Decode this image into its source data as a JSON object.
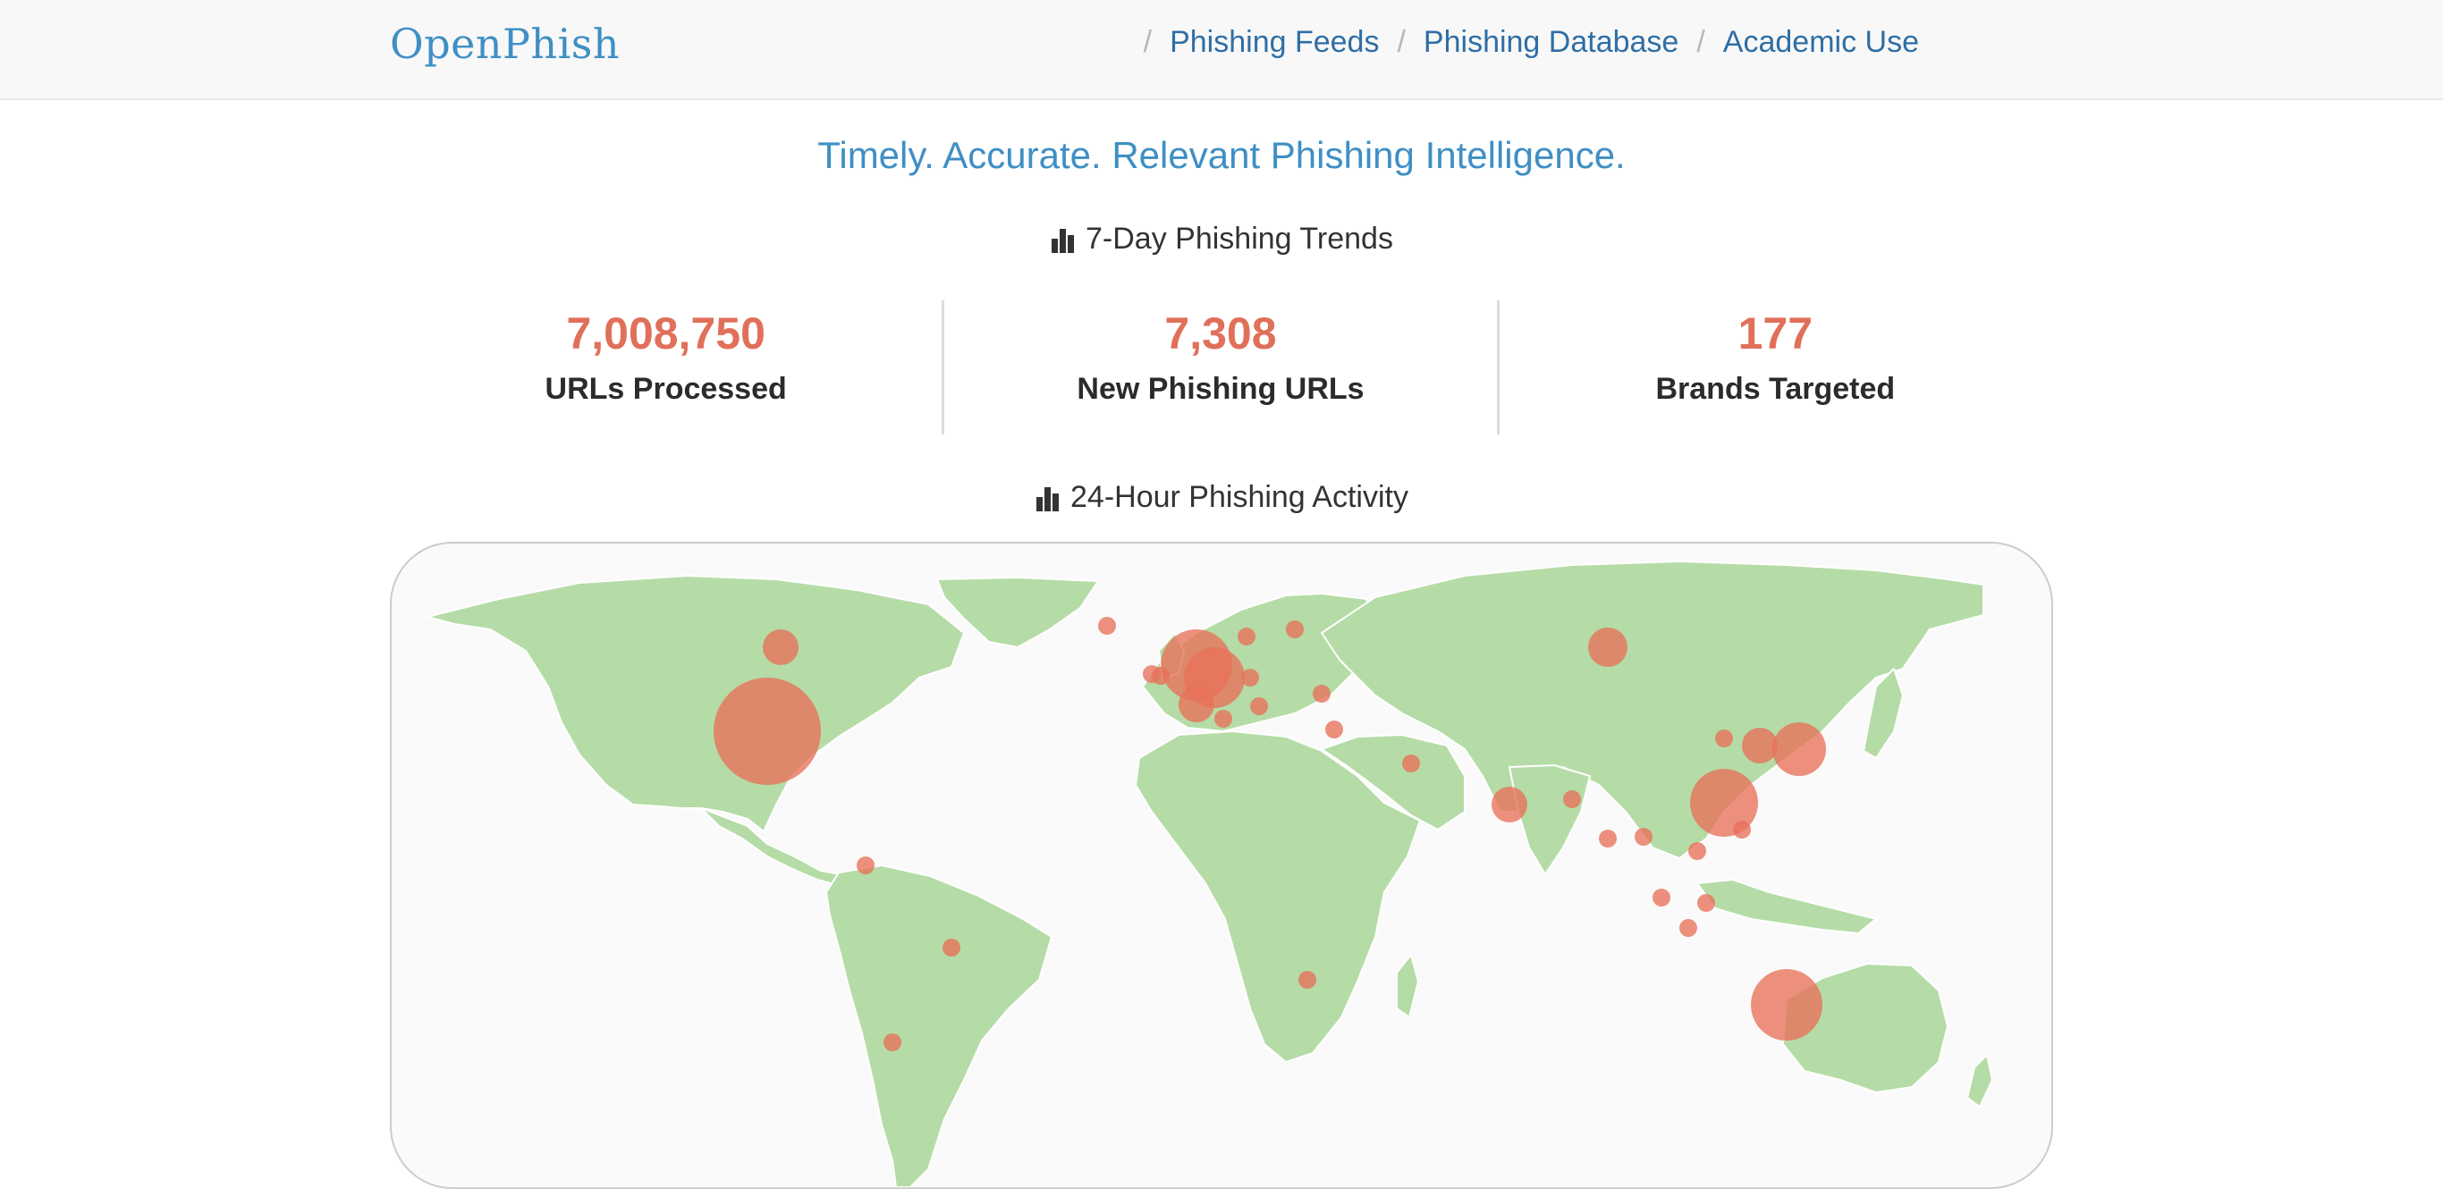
{
  "navbar": {
    "brand": "OpenPhish",
    "links": [
      "Phishing Feeds",
      "Phishing Database",
      "Academic Use"
    ],
    "separator": "/"
  },
  "tagline": "Timely. Accurate. Relevant Phishing Intelligence.",
  "trends": {
    "title": "7-Day Phishing Trends",
    "stats": [
      {
        "value": "7,008,750",
        "label": "URLs Processed"
      },
      {
        "value": "7,308",
        "label": "New Phishing URLs"
      },
      {
        "value": "177",
        "label": "Brands Targeted"
      }
    ]
  },
  "activity": {
    "title": "24-Hour Phishing Activity"
  },
  "colors": {
    "brand": "#3f8fc4",
    "link": "#2f6ea6",
    "stat_value": "#e0705a",
    "land": "#b5dca6",
    "bubble": "#e8715a"
  }
}
